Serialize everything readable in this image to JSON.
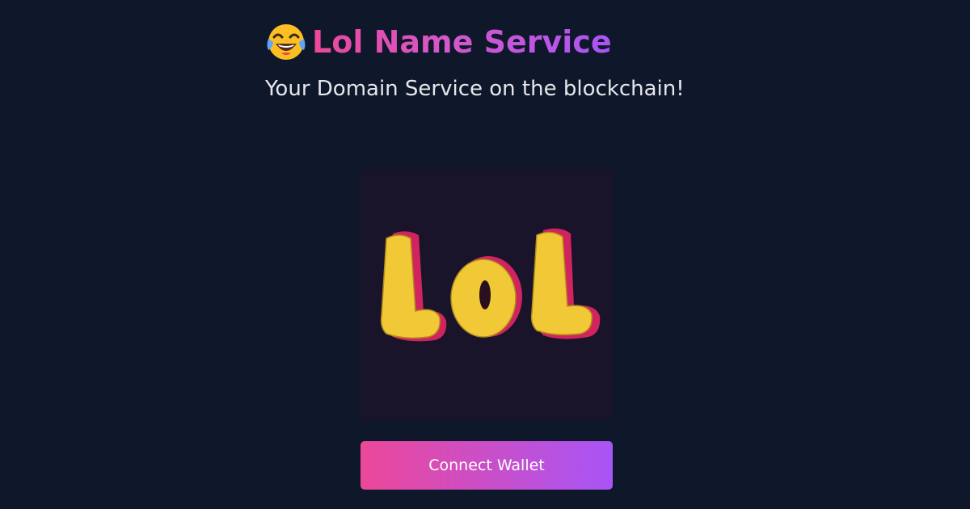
{
  "header": {
    "emoji_icon": "face-with-tears-of-joy-icon",
    "title": "Lol Name Service",
    "subtitle": "Your Domain Service on the blockchain!"
  },
  "hero_image": {
    "lettering": "LoL",
    "colors": {
      "background": "#19142a",
      "letter_fill": "#f1c835",
      "letter_shadow": "#d1245f"
    }
  },
  "connect_button": {
    "label": "Connect Wallet"
  },
  "colors": {
    "page_background": "#0f172a",
    "accent_start": "#ec4899",
    "accent_end": "#a855f7",
    "subtitle_text": "#e5e7eb"
  }
}
